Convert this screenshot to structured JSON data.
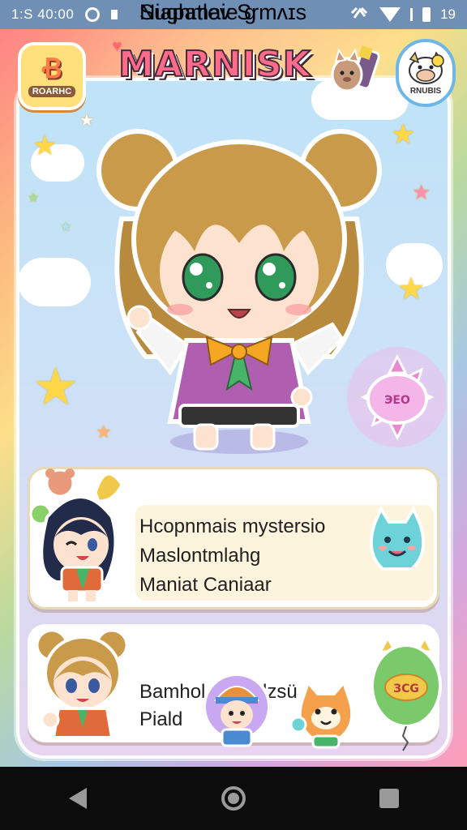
{
  "status_bar": {
    "time": "1:S 40:00",
    "right_text": "19",
    "icons": [
      "circle-status-icon",
      "notification-square-icon",
      "signal-icon",
      "wifi-icon",
      "battery-icon"
    ]
  },
  "header": {
    "title": "MARNISK",
    "left_badge_glyph": "Ꞗ",
    "left_badge_text": "ROARHC",
    "right_badge_text": "RNUBIS"
  },
  "cards": [
    {
      "title": "Niapatlev Srmʌɪs",
      "lines": [
        "Hcopnmais mystersio",
        "Maslontmlahg",
        "Maniat Caniaar"
      ]
    },
    {
      "title": "Sughmaie g",
      "lines": [
        "Bamhol",
        "Piald"
      ],
      "line_extra": "lzsü"
    }
  ],
  "balloon_label": "ЭЕО",
  "balloon_label_2": "ЗСG",
  "colors": {
    "status_bar": "#6f8fb5",
    "title_pink": "#ff6b8b",
    "card1_title": "#3f87c0",
    "card2_title": "#e0627a"
  },
  "nav": {
    "icons": [
      "back-icon",
      "home-icon",
      "recents-icon"
    ]
  }
}
